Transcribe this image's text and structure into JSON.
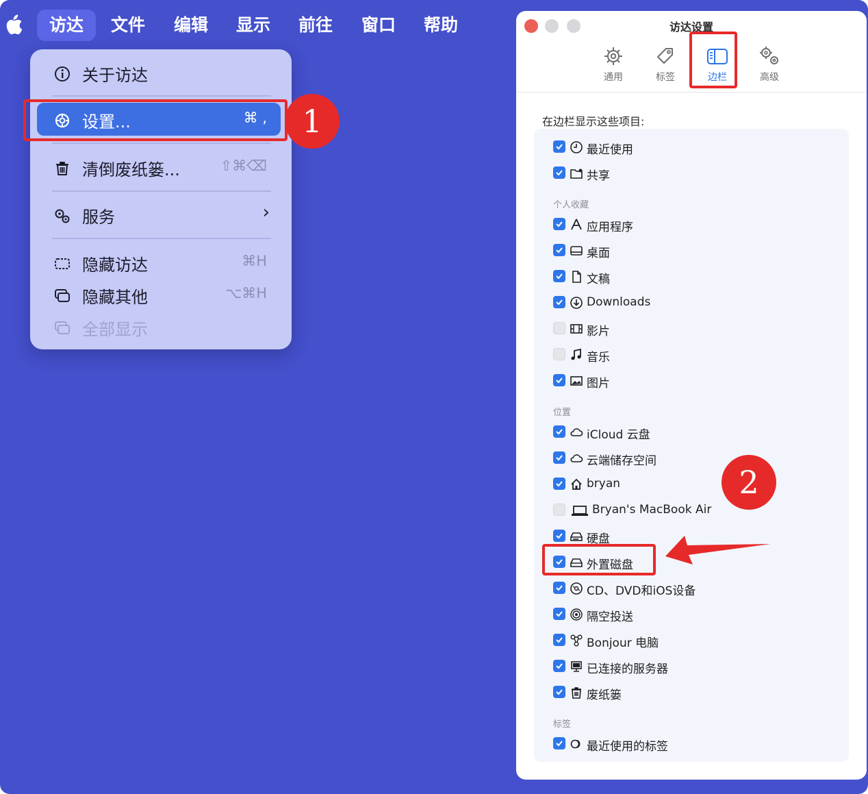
{
  "menubar": {
    "items": [
      "访达",
      "文件",
      "编辑",
      "显示",
      "前往",
      "窗口",
      "帮助"
    ],
    "active_index": 0
  },
  "dropdown": {
    "about": "关于访达",
    "settings": {
      "label": "设置...",
      "shortcut": "⌘ ,"
    },
    "empty_trash": {
      "label": "清倒废纸篓...",
      "shortcut": "⇧⌘⌫"
    },
    "services": {
      "label": "服务",
      "chevron": "›"
    },
    "hide": {
      "label": "隐藏访达",
      "shortcut": "⌘H"
    },
    "hide_others": {
      "label": "隐藏其他",
      "shortcut": "⌥⌘H"
    },
    "show_all": {
      "label": "全部显示"
    }
  },
  "annotations": {
    "badge1": "1",
    "badge2": "2"
  },
  "window": {
    "title": "访达设置",
    "tabs": [
      {
        "label": "通用",
        "icon": "gear-icon"
      },
      {
        "label": "标签",
        "icon": "tag-icon"
      },
      {
        "label": "边栏",
        "icon": "sidebar-icon",
        "active": true
      },
      {
        "label": "高级",
        "icon": "gears-icon"
      }
    ],
    "section_title": "在边栏显示这些项目:",
    "groups": {
      "favorites": "个人收藏",
      "locations": "位置",
      "tags": "标签"
    },
    "items": {
      "recents": {
        "label": "最近使用",
        "checked": true
      },
      "shared": {
        "label": "共享",
        "checked": true
      },
      "applications": {
        "label": "应用程序",
        "checked": true
      },
      "desktop": {
        "label": "桌面",
        "checked": true
      },
      "documents": {
        "label": "文稿",
        "checked": true
      },
      "downloads": {
        "label": "Downloads",
        "checked": true
      },
      "movies": {
        "label": "影片",
        "checked": false
      },
      "music": {
        "label": "音乐",
        "checked": false
      },
      "pictures": {
        "label": "图片",
        "checked": true
      },
      "icloud": {
        "label": "iCloud 云盘",
        "checked": true
      },
      "cloud_storage": {
        "label": "云端储存空间",
        "checked": true
      },
      "home": {
        "label": "bryan",
        "checked": true
      },
      "computer": {
        "label": "Bryan's MacBook Air",
        "checked": false
      },
      "hard_disks": {
        "label": "硬盘",
        "checked": true
      },
      "external_disks": {
        "label": "外置磁盘",
        "checked": true
      },
      "cds": {
        "label": "CD、DVD和iOS设备",
        "checked": true
      },
      "airdrop": {
        "label": "隔空投送",
        "checked": true
      },
      "bonjour": {
        "label": "Bonjour 电脑",
        "checked": true
      },
      "servers": {
        "label": "已连接的服务器",
        "checked": true
      },
      "trash": {
        "label": "废纸篓",
        "checked": true
      },
      "recent_tags": {
        "label": "最近使用的标签",
        "checked": true
      }
    }
  },
  "colors": {
    "desktop": "#4450cc",
    "accent": "#2f76e8",
    "annotation_red": "#e62a2a",
    "menu_bg": "#c6caf7"
  }
}
